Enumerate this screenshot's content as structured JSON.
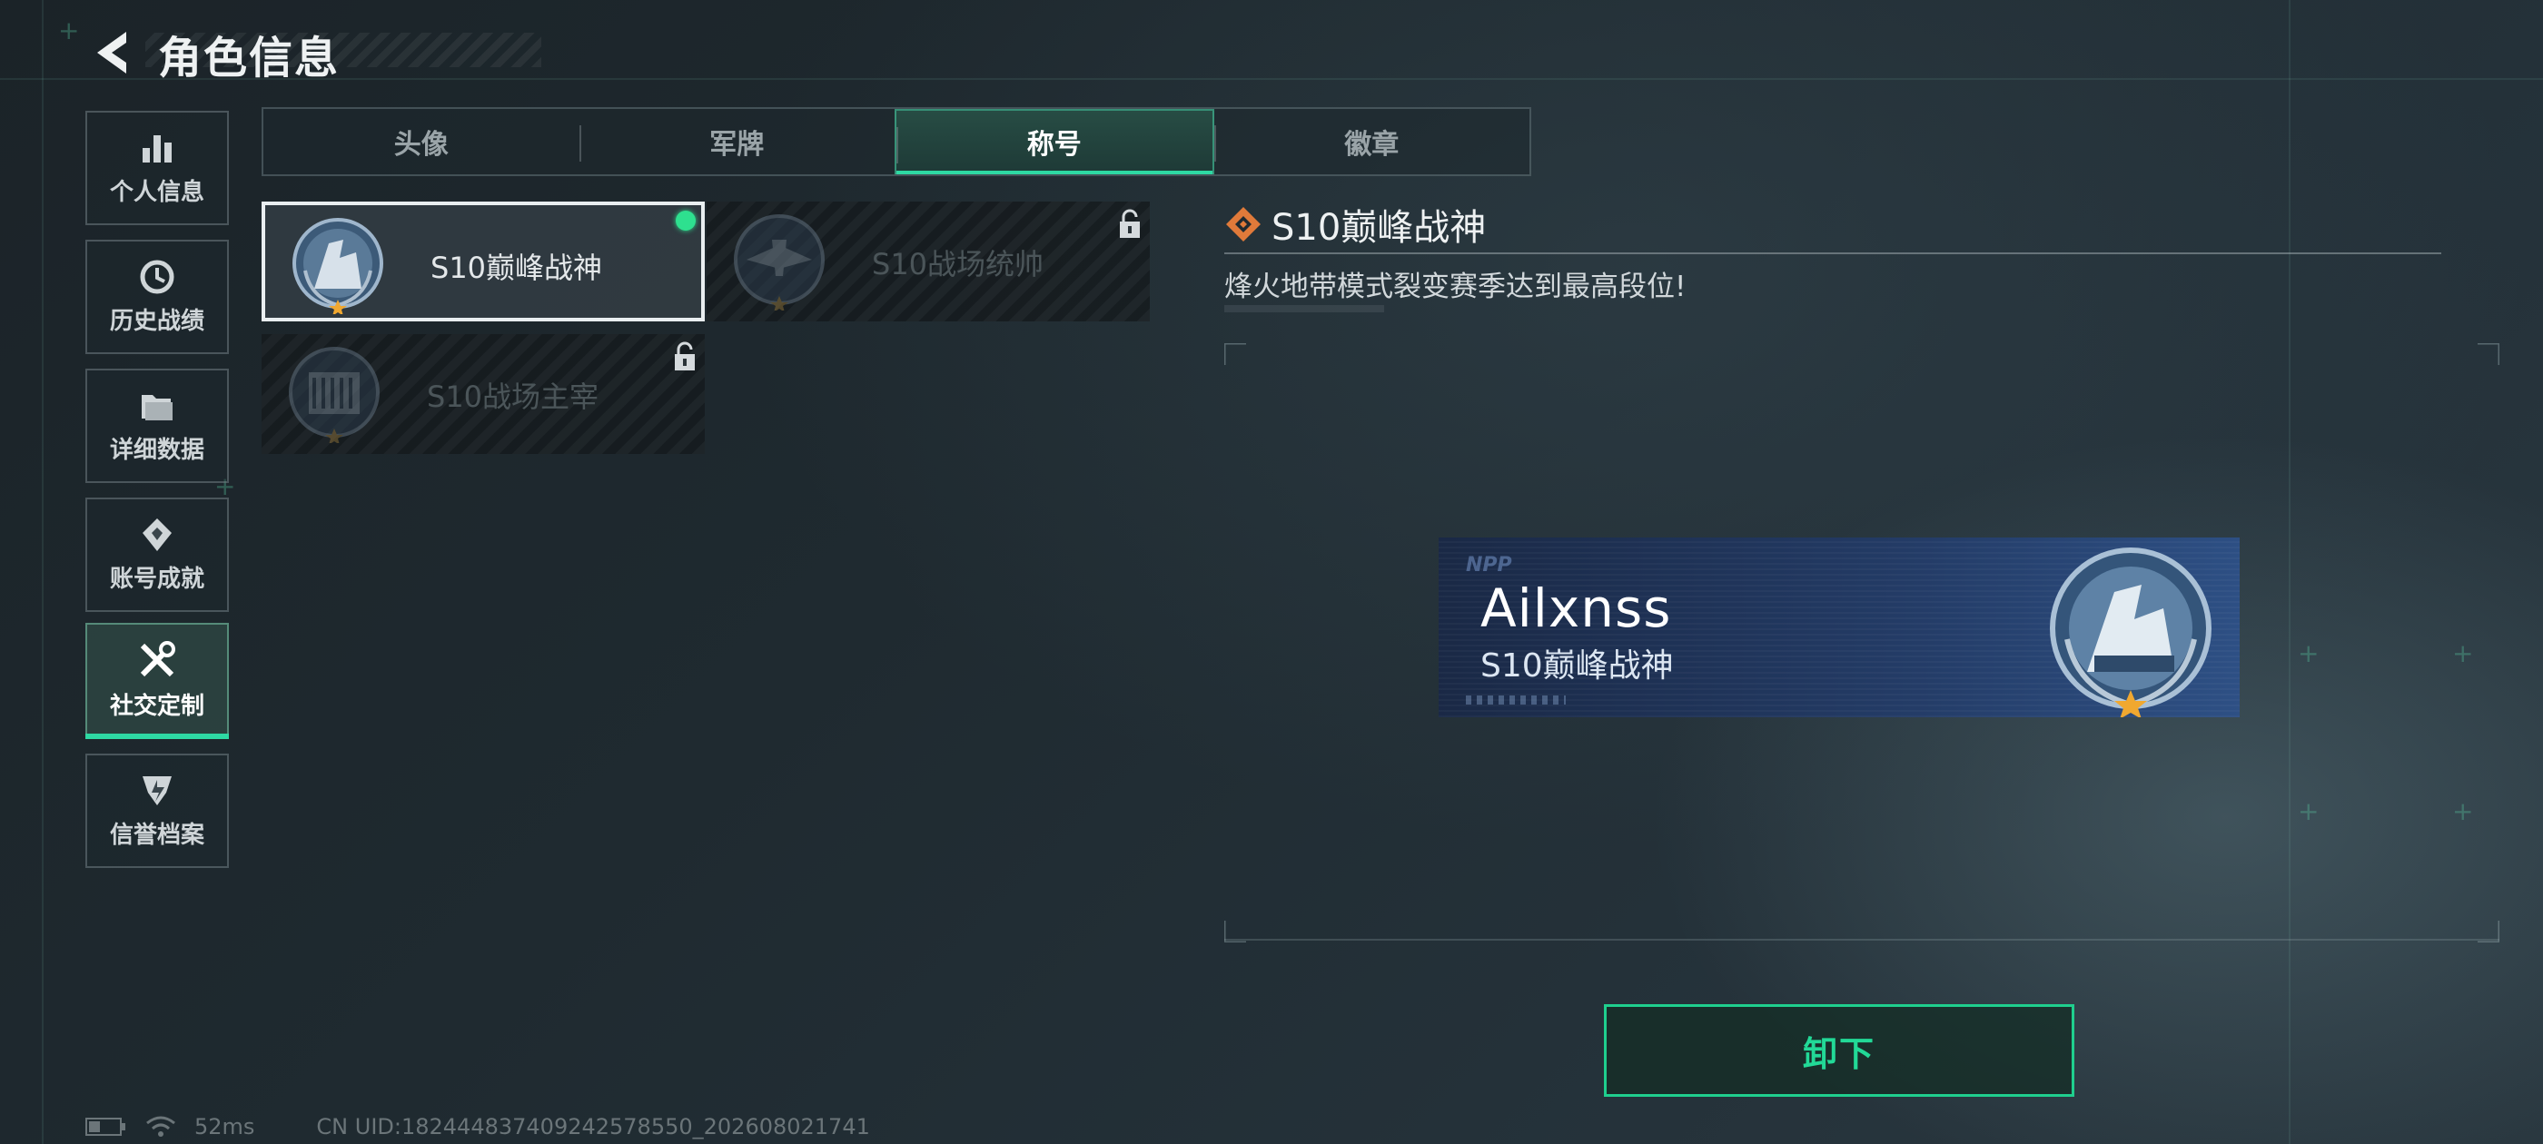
{
  "header": {
    "title": "角色信息",
    "back_icon": "chevron-left-icon"
  },
  "sidebar": {
    "items": [
      {
        "label": "个人信息",
        "icon": "bar-chart-icon",
        "active": false
      },
      {
        "label": "历史战绩",
        "icon": "history-icon",
        "active": false
      },
      {
        "label": "详细数据",
        "icon": "folder-icon",
        "active": false
      },
      {
        "label": "账号成就",
        "icon": "achievement-icon",
        "active": false
      },
      {
        "label": "社交定制",
        "icon": "tools-icon",
        "active": true
      },
      {
        "label": "信誉档案",
        "icon": "shield-icon",
        "active": false
      }
    ]
  },
  "tabs": [
    {
      "label": "头像",
      "active": false
    },
    {
      "label": "军牌",
      "active": false
    },
    {
      "label": "称号",
      "active": true
    },
    {
      "label": "徽章",
      "active": false
    }
  ],
  "titles": [
    {
      "name": "S10巅峰战神",
      "state": "equipped"
    },
    {
      "name": "S10战场统帅",
      "state": "locked"
    },
    {
      "name": "S10战场主宰",
      "state": "locked"
    }
  ],
  "detail": {
    "title": "S10巅峰战神",
    "description": "烽火地带模式裂变赛季达到最高段位!"
  },
  "preview": {
    "logo": "NPP",
    "player_name": "Ailxnss",
    "title": "S10巅峰战神"
  },
  "actions": {
    "unequip_label": "卸下"
  },
  "status": {
    "ping": "52ms",
    "uid": "CN UID:1824448374092425785​50_202608021741"
  },
  "colors": {
    "accent": "#2ed9a3",
    "online_dot": "#2ee08f",
    "detail_icon": "#e07a3a",
    "star": "#f0a830"
  }
}
